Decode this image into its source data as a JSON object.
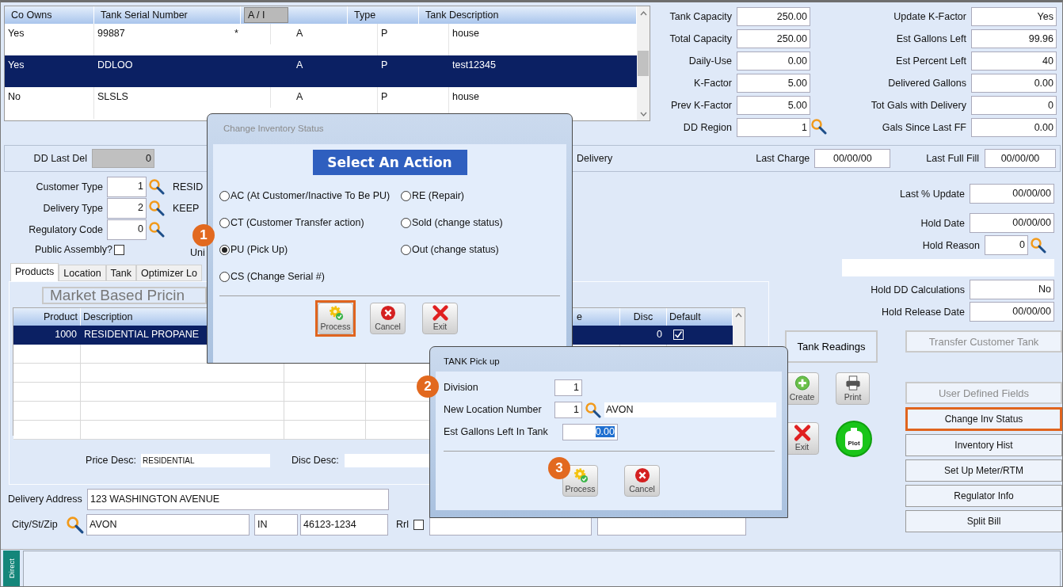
{
  "tank_list": {
    "columns": [
      {
        "label": "Co Owns",
        "highlighted": false
      },
      {
        "label": "Tank Serial Number",
        "highlighted": false
      },
      {
        "label": "A / I",
        "highlighted": true
      },
      {
        "label": "Type",
        "highlighted": false
      },
      {
        "label": "Tank Description",
        "highlighted": false
      }
    ],
    "rows": [
      {
        "co_owns": "Yes",
        "serial": "99887",
        "flag": "*",
        "a_i": "A",
        "type": "P",
        "description": "house",
        "selected": false
      },
      {
        "co_owns": "Yes",
        "serial": "DDLOO",
        "a_i": "A",
        "type": "P",
        "description": "test12345",
        "selected": true
      },
      {
        "co_owns": "No",
        "serial": "SLSLS",
        "a_i": "A",
        "type": "P",
        "description": "house",
        "selected": false
      }
    ]
  },
  "capacity_fields": [
    {
      "label": "Tank Capacity",
      "value": "250.00"
    },
    {
      "label": "Total Capacity",
      "value": "250.00"
    },
    {
      "label": "Daily-Use",
      "value": "0.00"
    },
    {
      "label": "K-Factor",
      "value": "5.00"
    },
    {
      "label": "Prev K-Factor",
      "value": "5.00"
    },
    {
      "label": "DD Region",
      "value": "1",
      "lookup": true
    }
  ],
  "status_fields": [
    {
      "label": "Update K-Factor",
      "value": "Yes"
    },
    {
      "label": "Est Gallons Left",
      "value": "99.96"
    },
    {
      "label": "Est Percent Left",
      "value": "40"
    },
    {
      "label": "Delivered Gallons",
      "value": "0.00"
    },
    {
      "label": "Tot Gals with Delivery",
      "value": "0"
    },
    {
      "label": "Gals Since Last FF",
      "value": "0.00"
    }
  ],
  "dd_strip": {
    "dd_last_del": {
      "label": "DD Last Del",
      "value": "0"
    },
    "delivery_label": "Delivery",
    "last_charge": {
      "label": "Last Charge",
      "value": "00/00/00"
    },
    "last_full_fill": {
      "label": "Last Full Fill",
      "value": "00/00/00"
    }
  },
  "customer_fields": [
    {
      "label": "Customer Type",
      "value": "1",
      "description": "RESID"
    },
    {
      "label": "Delivery Type",
      "value": "2",
      "description": "KEEP"
    },
    {
      "label": "Regulatory Code",
      "value": "0"
    }
  ],
  "public_assembly": {
    "label": "Public Assembly?",
    "checked": false
  },
  "uni_label": "Uni",
  "tabs": [
    {
      "label": "Products",
      "selected": true
    },
    {
      "label": "Location",
      "selected": false
    },
    {
      "label": "Tank",
      "selected": false
    },
    {
      "label": "Optimizer Lo",
      "selected": false
    }
  ],
  "products": {
    "pricing_title": "Market Based Pricin",
    "columns": [
      "Product",
      "Description",
      "e",
      "Disc",
      "Default"
    ],
    "rows": [
      {
        "product": "1000",
        "description": "RESIDENTIAL PROPANE",
        "disc": "0",
        "default": true,
        "selected": true
      }
    ],
    "price_desc": {
      "label": "Price Desc:",
      "value": "RESIDENTIAL"
    },
    "disc_desc": {
      "label": "Disc Desc:"
    }
  },
  "address": {
    "delivery": {
      "label": "Delivery Address",
      "value": "123 WASHINGTON AVENUE"
    },
    "city_label": "City/St/Zip",
    "city": "AVON",
    "state": "IN",
    "zip": "46123-1234",
    "rrl": {
      "label": "Rrl",
      "checked": false
    }
  },
  "hold_fields": [
    {
      "kind": "field",
      "label": "Last % Update",
      "value": "00/00/00"
    },
    {
      "kind": "field",
      "label": "Hold Date",
      "value": "00/00/00"
    },
    {
      "kind": "lookup",
      "label": "Hold Reason",
      "value": "0"
    },
    {
      "kind": "blank"
    },
    {
      "kind": "field",
      "label": "Hold DD Calculations",
      "value": "No"
    },
    {
      "kind": "field",
      "label": "Hold Release Date",
      "value": "00/00/00"
    }
  ],
  "tank_readings": "Tank Readings",
  "tool_buttons": [
    {
      "label": "Create",
      "kind": "create"
    },
    {
      "label": "Print",
      "kind": "print"
    },
    {
      "label": "Exit",
      "kind": "exit"
    },
    {
      "label": "Plot",
      "kind": "plot"
    }
  ],
  "side_buttons": [
    {
      "label": "Transfer Customer Tank",
      "disabled": true,
      "highlighted": false
    },
    {
      "label": "User Defined Fields",
      "disabled": true,
      "highlighted": false
    },
    {
      "label": "Change Inv Status",
      "disabled": false,
      "highlighted": true
    },
    {
      "label": "Inventory Hist",
      "disabled": false,
      "highlighted": false
    },
    {
      "label": "Set Up Meter/RTM",
      "disabled": false,
      "highlighted": false
    },
    {
      "label": "Regulator Info",
      "disabled": false,
      "highlighted": false
    },
    {
      "label": "Split Bill",
      "disabled": false,
      "highlighted": false
    }
  ],
  "status_bar": {
    "tab": "Direct"
  },
  "inventory_dialog": {
    "title": "Change Inventory Status",
    "heading": "Select An Action",
    "options": [
      {
        "label": "AC (At Customer/Inactive To Be PU)",
        "selected": false
      },
      {
        "label": "RE (Repair)",
        "selected": false
      },
      {
        "label": "CT (Customer Transfer action)",
        "selected": false
      },
      {
        "label": "Sold (change status)",
        "selected": false
      },
      {
        "label": "PU (Pick Up)",
        "selected": true,
        "callout": "1"
      },
      {
        "label": "Out (change status)",
        "selected": false
      },
      {
        "label": "CS (Change Serial #)",
        "selected": false
      }
    ],
    "buttons": [
      {
        "label": "Process",
        "kind": "process",
        "highlighted": true
      },
      {
        "label": "Cancel",
        "kind": "cancel",
        "highlighted": false
      },
      {
        "label": "Exit",
        "kind": "exit",
        "highlighted": false
      }
    ]
  },
  "pickup_dialog": {
    "title": "TANK Pick up",
    "fields": [
      {
        "label": "Division",
        "value": "1",
        "callout": "2"
      },
      {
        "label": "New Location Number",
        "value": "1",
        "lookup": true,
        "description": "AVON"
      },
      {
        "label": "Est Gallons Left In Tank",
        "value": "0.00",
        "text_selected": true
      }
    ],
    "buttons": [
      {
        "label": "Process",
        "kind": "process",
        "callout": "3"
      },
      {
        "label": "Cancel",
        "kind": "cancel"
      }
    ]
  }
}
